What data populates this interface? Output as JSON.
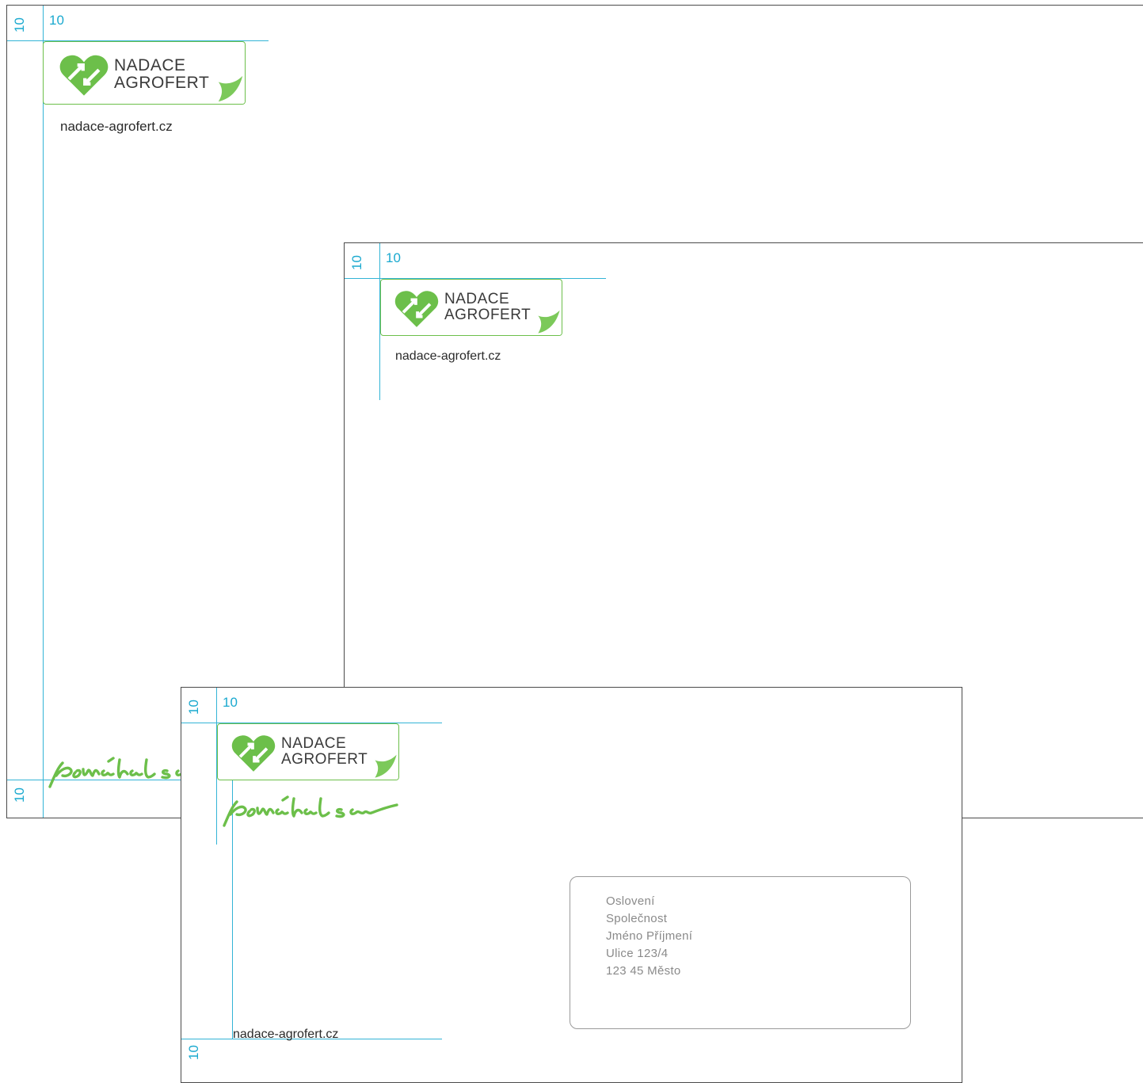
{
  "colors": {
    "guide": "#33b4d6",
    "brand_green": "#6cbf4a",
    "frame": "#4a4a4a"
  },
  "dimension_label": "10",
  "logo": {
    "line1": "NADACE",
    "line2": "AGROFERT",
    "icon": "heart-arrow-icon"
  },
  "website": "nadace-agrofert.cz",
  "slogan": "pomáhat srdcem",
  "address": {
    "lines": [
      "Oslovení",
      "Společnost",
      "Jméno Příjmení",
      "Ulice 123/4",
      "123 45 Město"
    ]
  }
}
